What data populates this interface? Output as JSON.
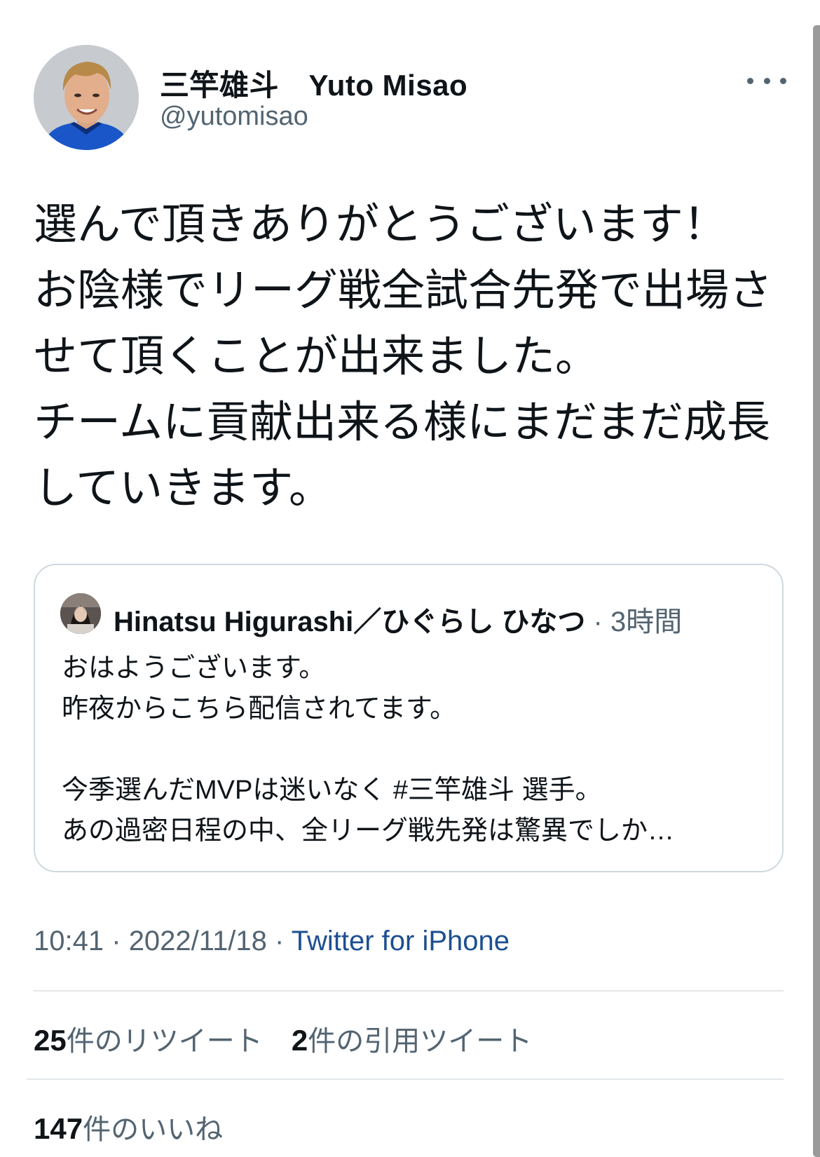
{
  "author": {
    "name": "三竿雄斗　Yuto Misao",
    "handle": "@yutomisao"
  },
  "tweet": {
    "lines": [
      "選んで頂きありがとうございます！",
      "お陰様でリーグ戦全試合先発で出場さ",
      "せて頂くことが出来ました。",
      "チームに貢献出来る様にまだまだ成長",
      "していきます。"
    ]
  },
  "quote": {
    "author": "Hinatsu Higurashi／ひぐらし ひなつ",
    "separator": "·",
    "time": "3時間",
    "lines": [
      "おはようございます。",
      "昨夜からこちら配信されてます。",
      "",
      "今季選んだMVPは迷いなく #三竿雄斗 選手。",
      "あの過密日程の中、全リーグ戦先発は驚異でしか…"
    ]
  },
  "meta": {
    "time": "10:41",
    "dot1": "·",
    "date": "2022/11/18",
    "dot2": "·",
    "source": "Twitter for iPhone"
  },
  "stats": {
    "retweets": {
      "count": "25",
      "label": "件のリツイート"
    },
    "quotes": {
      "count": "2",
      "label": "件の引用ツイート"
    },
    "likes": {
      "count": "147",
      "label": "件のいいね"
    }
  },
  "colors": {
    "text": "#0f1419",
    "secondary": "#536471",
    "link": "#1d4f91",
    "border": "#cfd9de",
    "divider": "#e3e7ea",
    "jersey": "#1a56c8"
  },
  "icons": {
    "more": "more-horizontal-icon"
  }
}
